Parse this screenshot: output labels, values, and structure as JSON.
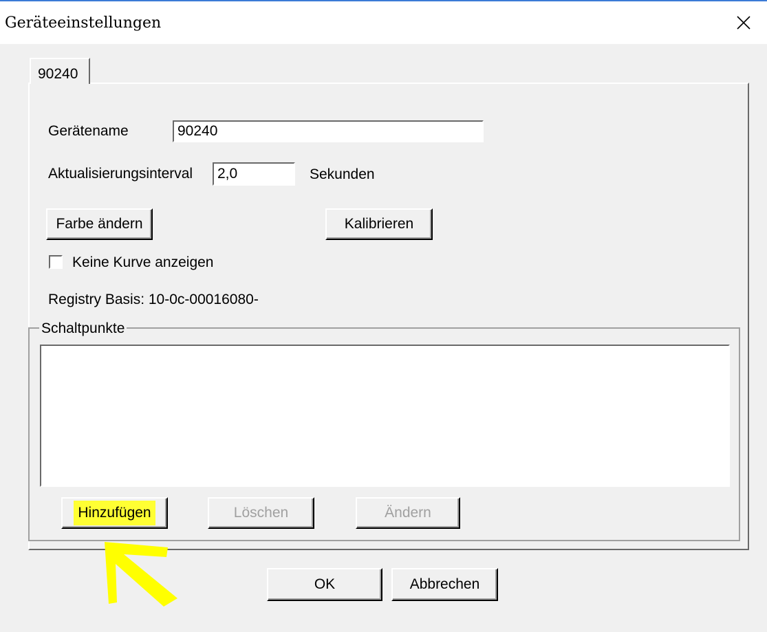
{
  "window": {
    "title": "Geräteeinstellungen",
    "close_icon": "close-icon"
  },
  "tabs": [
    {
      "label": "90240",
      "selected": true
    }
  ],
  "form": {
    "device_name_label": "Gerätename",
    "device_name_value": "90240",
    "update_interval_label": "Aktualisierungsinterval",
    "update_interval_value": "2,0",
    "update_interval_unit": "Sekunden",
    "change_color_label": "Farbe ändern",
    "calibrate_label": "Kalibrieren",
    "no_curve_label": "Keine Kurve anzeigen",
    "no_curve_checked": false,
    "registry_text": "Registry Basis: 10-0c-00016080-"
  },
  "switch_points": {
    "group_label": "Schaltpunkte",
    "items": [],
    "add_label": "Hinzufügen",
    "delete_label": "Löschen",
    "edit_label": "Ändern"
  },
  "footer": {
    "ok_label": "OK",
    "cancel_label": "Abbrechen"
  },
  "colors": {
    "highlight": "#ffff33",
    "annotation_arrow": "#ffff00",
    "accent_line": "#3b7bd6"
  }
}
